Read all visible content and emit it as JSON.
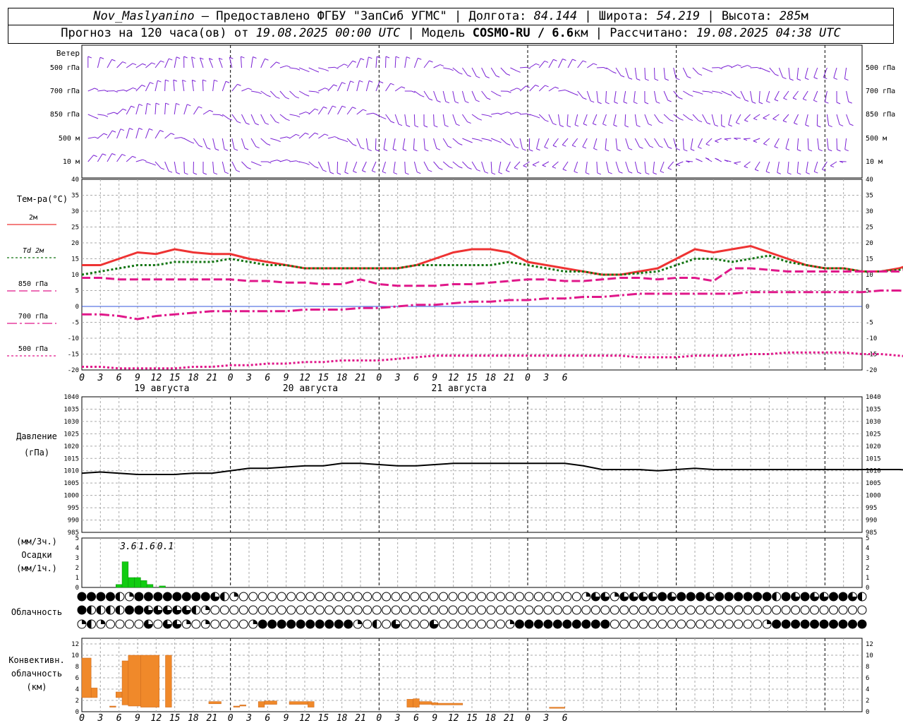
{
  "header": {
    "station": "Nov_Maslyanino",
    "provider": "Предоставлено ФГБУ \"ЗапСиб УГМС\"",
    "lon_label": "Долгота:",
    "lon": "84.144",
    "lat_label": "Широта:",
    "lat": "54.219",
    "alt_label": "Высота:",
    "alt": "285",
    "alt_unit": "м",
    "forecast_label": "Прогноз на 120 часа(ов) от",
    "forecast_start": "19.08.2025 00:00 UTC",
    "model_label": "Модель",
    "model": "COSMO-RU / 6.6",
    "model_unit": "км",
    "computed_label": "Рассчитано:",
    "computed": "19.08.2025 04:38 UTC"
  },
  "x_ticks": [
    "0",
    "3",
    "6",
    "9",
    "12",
    "15",
    "18",
    "21",
    "0",
    "3",
    "6",
    "9",
    "12",
    "15",
    "18",
    "21",
    "0",
    "3",
    "6",
    "9",
    "12",
    "15",
    "18",
    "21",
    "0",
    "3",
    "6"
  ],
  "day_labels": [
    "19 августа",
    "20 августа",
    "21 августа"
  ],
  "wind": {
    "title": "Ветер",
    "levels": [
      "500 гПа",
      "700 гПа",
      "850 гПа",
      "500 м",
      "10  м"
    ],
    "color": "#7b22d4"
  },
  "chart_data": [
    {
      "type": "line",
      "name": "temperature",
      "ylabel": "Тем-ра(°C)",
      "ylim": [
        -20,
        40
      ],
      "yticks": [
        "40",
        "35",
        "30",
        "25",
        "20",
        "15",
        "10",
        "5",
        "0",
        "-5",
        "-10",
        "-15",
        "-20"
      ],
      "x_hours_step": 3,
      "series": [
        {
          "name": "2м",
          "color": "#ee3333",
          "dash": "solid",
          "values": [
            13,
            13,
            15,
            17,
            16.5,
            18,
            17,
            16.5,
            16.5,
            15,
            14,
            13,
            12,
            12,
            12,
            12,
            12,
            12,
            13,
            15,
            17,
            18,
            18,
            17,
            14,
            13,
            12,
            11,
            10,
            10,
            11,
            12,
            15,
            18,
            17,
            18,
            19,
            17,
            15,
            13,
            12,
            12,
            11,
            11,
            12,
            14,
            16,
            19
          ]
        },
        {
          "name": "Td  2м",
          "color": "#137513",
          "dash": "dotted",
          "values": [
            10,
            11,
            12,
            13,
            13,
            14,
            14,
            14,
            15,
            14,
            13,
            13,
            12,
            12,
            12,
            12,
            12,
            12,
            13,
            13,
            13,
            13,
            13,
            14,
            13,
            12,
            11,
            11,
            10,
            10,
            10.5,
            11,
            13,
            15,
            15,
            14,
            15,
            16,
            14,
            13,
            12,
            12,
            11,
            11,
            11.5,
            13,
            15,
            18
          ]
        },
        {
          "name": "850 гПа",
          "color": "#e0188a",
          "dash": "long",
          "values": [
            9,
            9,
            8.5,
            8.5,
            8.5,
            8.5,
            8.5,
            8.5,
            8.5,
            8,
            8,
            7.5,
            7.5,
            7,
            7,
            8.5,
            7,
            6.5,
            6.5,
            6.5,
            7,
            7,
            7.5,
            8,
            8.5,
            8.5,
            8,
            8,
            8.5,
            9,
            9,
            8.5,
            9,
            9,
            8,
            12,
            12,
            11.5,
            11,
            11,
            11,
            11,
            11,
            11,
            11,
            12.5,
            13,
            14.5
          ]
        },
        {
          "name": "700 гПа",
          "color": "#e0188a",
          "dash": "dashdot",
          "values": [
            -2.5,
            -2.5,
            -3,
            -4,
            -3,
            -2.5,
            -2,
            -1.5,
            -1.5,
            -1.5,
            -1.5,
            -1.5,
            -1,
            -1,
            -1,
            -0.5,
            -0.5,
            0,
            0.5,
            0.5,
            1,
            1.5,
            1.5,
            2,
            2,
            2.5,
            2.5,
            3,
            3,
            3.5,
            4,
            4,
            4,
            4,
            4,
            4,
            4.5,
            4.5,
            4.5,
            4.5,
            4.5,
            4.5,
            4.5,
            5,
            5,
            4.5,
            4,
            3.5
          ]
        },
        {
          "name": "500 гПа",
          "color": "#e0188a",
          "dash": "dotted",
          "values": [
            -19,
            -19,
            -19.5,
            -19.5,
            -19.5,
            -19.5,
            -19,
            -19,
            -18.5,
            -18.5,
            -18,
            -18,
            -17.5,
            -17.5,
            -17,
            -17,
            -17,
            -16.5,
            -16,
            -15.5,
            -15.5,
            -15.5,
            -15.5,
            -15.5,
            -15.5,
            -15.5,
            -15.5,
            -15.5,
            -15.5,
            -15.5,
            -16,
            -16,
            -16,
            -15.5,
            -15.5,
            -15.5,
            -15,
            -15,
            -14.5,
            -14.5,
            -14.5,
            -14.5,
            -15,
            -15,
            -15.5,
            -16,
            -16,
            -15.5
          ]
        }
      ]
    },
    {
      "type": "line",
      "name": "pressure",
      "ylabel": "Давление",
      "yunit": "(гПа)",
      "ylim": [
        985,
        1040
      ],
      "yticks": [
        "1040",
        "1035",
        "1030",
        "1025",
        "1020",
        "1015",
        "1010",
        "1005",
        "1000",
        "995",
        "990",
        "985"
      ],
      "series": [
        {
          "name": "pressure",
          "color": "#000000",
          "values": [
            1009,
            1009.5,
            1009,
            1008.5,
            1008.5,
            1008.5,
            1009,
            1009,
            1010,
            1011,
            1011,
            1011.5,
            1012,
            1012,
            1013,
            1013,
            1012.5,
            1012,
            1012,
            1012.5,
            1013,
            1013,
            1013,
            1013,
            1013,
            1013,
            1013,
            1012,
            1010.5,
            1010.5,
            1010.5,
            1010,
            1010.5,
            1011,
            1010.5,
            1010.5,
            1010.5,
            1010.5,
            1010.5,
            1010.5,
            1010.5,
            1010.5,
            1010.5,
            1010.5,
            1010.5,
            1010,
            1009.5,
            1009
          ]
        }
      ]
    },
    {
      "type": "bar",
      "name": "precipitation",
      "ylabel": "(мм/3ч.)",
      "ylabel2": "Осадки",
      "ylabel3": "(мм/1ч.)",
      "ylim": [
        0,
        5
      ],
      "yticks": [
        "5",
        "4",
        "3",
        "2",
        "1",
        "0"
      ],
      "color": "#11cc11",
      "bars_hour": [
        [
          6,
          0.3
        ],
        [
          7,
          2.6
        ],
        [
          8,
          1.0
        ],
        [
          9,
          1.0
        ],
        [
          10,
          0.7
        ],
        [
          11,
          0.3
        ],
        [
          13,
          0.15
        ]
      ],
      "totals": [
        {
          "hour": 7.5,
          "text": "3.6"
        },
        {
          "hour": 10.5,
          "text": "1.6"
        },
        {
          "hour": 13.5,
          "text": "0.1"
        }
      ]
    },
    {
      "type": "table",
      "name": "cloudiness",
      "ylabel": "Облачность",
      "rows": [
        [
          4,
          4,
          4,
          4,
          2,
          1,
          4,
          4,
          4,
          4,
          4,
          4,
          4,
          4,
          3,
          2,
          1,
          0,
          0,
          0,
          0,
          0,
          0,
          0,
          0,
          0,
          0,
          0,
          0,
          0,
          0,
          0,
          0,
          0,
          0,
          0,
          0,
          0,
          0,
          0,
          0,
          0,
          0,
          0,
          0,
          0,
          0,
          0,
          0,
          0,
          0,
          0,
          0,
          1,
          3,
          3,
          1,
          3,
          3,
          3,
          3,
          4,
          3,
          4,
          4,
          4,
          3,
          4,
          4,
          4,
          4,
          4,
          4,
          2,
          4,
          3,
          4,
          3,
          3,
          4,
          4,
          3,
          2
        ],
        [
          4,
          2,
          2,
          2,
          2,
          4,
          4,
          3,
          3,
          3,
          3,
          3,
          2,
          1,
          0,
          0,
          0,
          0,
          0,
          0,
          0,
          0,
          0,
          0,
          0,
          0,
          0,
          0,
          0,
          0,
          0,
          0,
          0,
          0,
          0,
          0,
          0,
          0,
          0,
          0,
          0,
          0,
          0,
          0,
          0,
          0,
          0,
          0,
          0,
          0,
          0,
          0,
          0,
          0,
          0,
          0,
          0,
          0,
          0,
          0,
          0,
          0,
          0,
          0,
          0,
          0,
          0,
          0,
          0,
          0,
          0,
          0,
          0,
          0,
          0,
          0,
          0,
          0,
          0,
          0,
          0,
          0,
          0
        ],
        [
          1,
          2,
          1,
          0,
          0,
          0,
          0,
          3,
          0,
          3,
          3,
          1,
          0,
          1,
          0,
          0,
          0,
          0,
          1,
          4,
          4,
          4,
          4,
          4,
          4,
          4,
          4,
          4,
          4,
          1,
          0,
          2,
          0,
          3,
          0,
          0,
          0,
          3,
          0,
          0,
          0,
          0,
          0,
          0,
          0,
          1,
          4,
          4,
          4,
          4,
          4,
          4,
          4,
          4,
          4,
          4,
          0,
          0,
          0,
          0,
          0,
          0,
          0,
          0,
          0,
          0,
          0,
          0,
          0,
          0,
          0,
          0,
          1,
          4,
          4,
          4,
          4,
          4,
          4,
          4,
          4,
          4,
          4
        ]
      ]
    },
    {
      "type": "bar",
      "name": "convective_cloudiness",
      "ylabel": "Конвективн.",
      "ylabel2": "облачность",
      "yunit": "(км)",
      "ylim": [
        0,
        13
      ],
      "yticks": [
        "12",
        "10",
        "8",
        "6",
        "4",
        "2",
        "0"
      ],
      "color": "#f0892a",
      "bars": [
        {
          "h0": 0,
          "h1": 1.5,
          "base": 2.5,
          "top": 9.5
        },
        {
          "h0": 1.5,
          "h1": 2.5,
          "base": 2.5,
          "top": 4.2
        },
        {
          "h0": 4.5,
          "h1": 5.5,
          "base": 0.8,
          "top": 1.0
        },
        {
          "h0": 5.5,
          "h1": 6.5,
          "base": 2.5,
          "top": 3.5
        },
        {
          "h0": 6.5,
          "h1": 7.5,
          "base": 1.2,
          "top": 9.0
        },
        {
          "h0": 7.5,
          "h1": 9.5,
          "base": 1.0,
          "top": 10.0
        },
        {
          "h0": 9.5,
          "h1": 12.5,
          "base": 0.8,
          "top": 10.0
        },
        {
          "h0": 13.5,
          "h1": 14.5,
          "base": 0.8,
          "top": 10.0
        },
        {
          "h0": 20.5,
          "h1": 22.5,
          "base": 1.4,
          "top": 1.8
        },
        {
          "h0": 24.5,
          "h1": 25.5,
          "base": 0.8,
          "top": 1.0
        },
        {
          "h0": 25.5,
          "h1": 26.5,
          "base": 1.0,
          "top": 1.2
        },
        {
          "h0": 28.5,
          "h1": 29.5,
          "base": 0.8,
          "top": 1.8
        },
        {
          "h0": 29.5,
          "h1": 31.5,
          "base": 1.3,
          "top": 1.9
        },
        {
          "h0": 33.5,
          "h1": 36.5,
          "base": 1.3,
          "top": 1.8
        },
        {
          "h0": 36.5,
          "h1": 37.5,
          "base": 0.8,
          "top": 1.8
        },
        {
          "h0": 52.5,
          "h1": 53.5,
          "base": 0.8,
          "top": 2.2
        },
        {
          "h0": 53.5,
          "h1": 54.5,
          "base": 0.8,
          "top": 2.3
        },
        {
          "h0": 54.5,
          "h1": 56.5,
          "base": 1.3,
          "top": 1.8
        },
        {
          "h0": 56.5,
          "h1": 57.5,
          "base": 1.2,
          "top": 1.6
        },
        {
          "h0": 57.5,
          "h1": 61.5,
          "base": 1.2,
          "top": 1.5
        },
        {
          "h0": 75.5,
          "h1": 78.0,
          "base": 0.6,
          "top": 0.8
        }
      ]
    }
  ]
}
